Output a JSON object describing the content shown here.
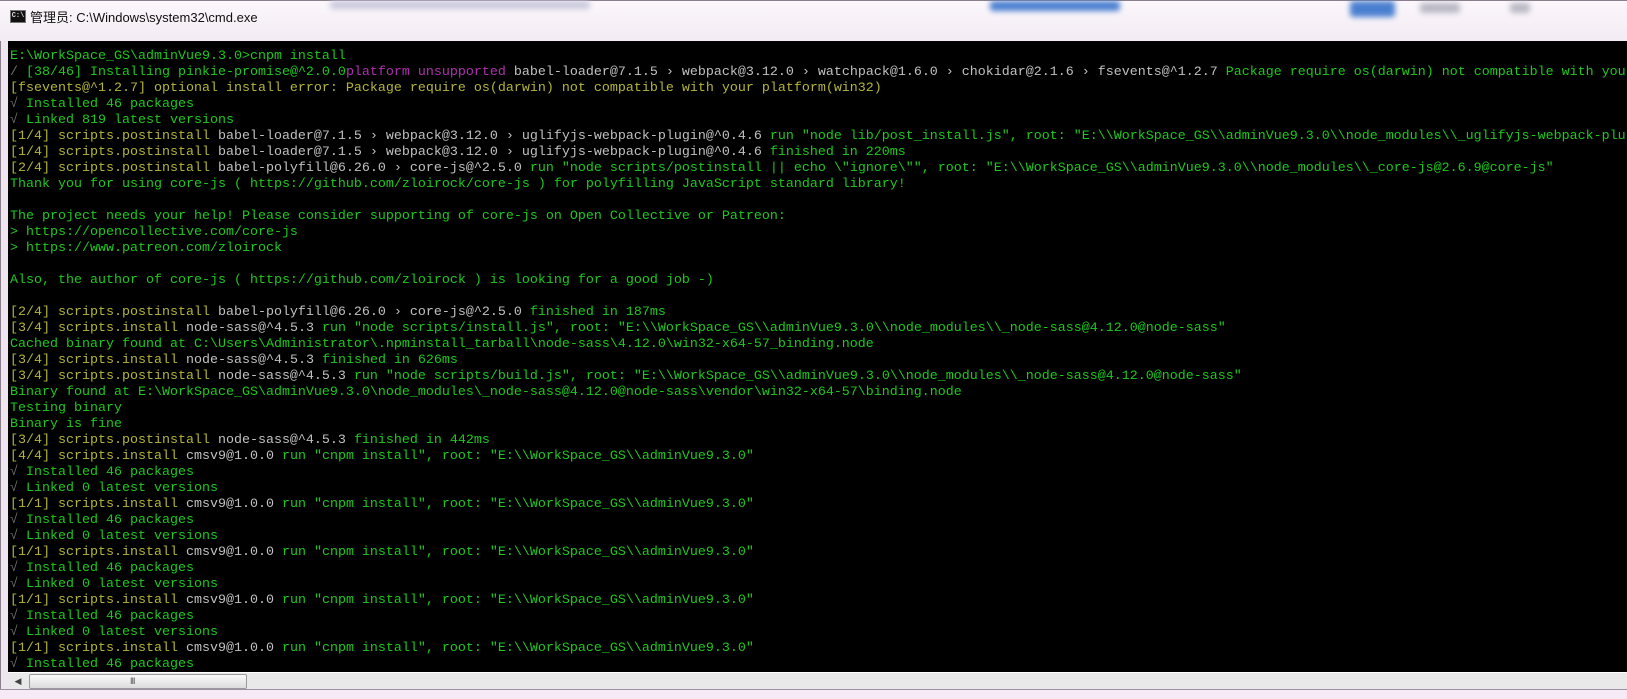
{
  "window": {
    "title": "管理员: C:\\Windows\\system32\\cmd.exe",
    "icon": "cmd-icon",
    "icon_text": "C:\\"
  },
  "colors": {
    "c": "#c0c0c0",
    "g": "#1ec81e",
    "y": "#b4b43a",
    "m": "#b030b0",
    "k": "#707070",
    "background": "#000000"
  },
  "terminal": {
    "lines": [
      [
        [
          "g",
          "E:\\WorkSpace_GS\\adminVue9.3.0>cnpm install"
        ]
      ],
      [
        [
          "k",
          "/ "
        ],
        [
          "g",
          "[38/46] Installing pinkie-promise@^2.0.0"
        ],
        [
          "m",
          "platform unsupported "
        ],
        [
          "c",
          "babel-loader@7.1.5 › webpack@3.12.0 › watchpack@1.6.0 › chokidar@2.1.6 › fsevents@^1.2.7 "
        ],
        [
          "g",
          "Package require os(darwin) not compatible with your"
        ]
      ],
      [
        [
          "y",
          "[fsevents@^1.2.7] optional install error: Package require os(darwin) not compatible with your platform(win32)"
        ]
      ],
      [
        [
          "k",
          "√ "
        ],
        [
          "g",
          "Installed 46 packages"
        ]
      ],
      [
        [
          "k",
          "√ "
        ],
        [
          "g",
          "Linked 819 latest versions"
        ]
      ],
      [
        [
          "y",
          "[1/4] scripts.postinstall "
        ],
        [
          "c",
          "babel-loader@7.1.5 › webpack@3.12.0 › uglifyjs-webpack-plugin@^0.4.6 "
        ],
        [
          "g",
          "run \"node lib/post_install.js\", root: \"E:\\\\WorkSpace_GS\\\\adminVue9.3.0\\\\node_modules\\\\_uglifyjs-webpack-plu"
        ]
      ],
      [
        [
          "y",
          "[1/4] scripts.postinstall "
        ],
        [
          "c",
          "babel-loader@7.1.5 › webpack@3.12.0 › uglifyjs-webpack-plugin@^0.4.6 "
        ],
        [
          "g",
          "finished in 220ms"
        ]
      ],
      [
        [
          "y",
          "[2/4] scripts.postinstall "
        ],
        [
          "c",
          "babel-polyfill@6.26.0 › core-js@^2.5.0 "
        ],
        [
          "g",
          "run \"node scripts/postinstall || echo \\\"ignore\\\"\", root: \"E:\\\\WorkSpace_GS\\\\adminVue9.3.0\\\\node_modules\\\\_core-js@2.6.9@core-js\""
        ]
      ],
      [
        [
          "g",
          "Thank you for using core-js ( https://github.com/zloirock/core-js ) for polyfilling JavaScript standard library!"
        ]
      ],
      [],
      [
        [
          "g",
          "The project needs your help! Please consider supporting of core-js on Open Collective or Patreon:"
        ]
      ],
      [
        [
          "g",
          "> https://opencollective.com/core-js"
        ]
      ],
      [
        [
          "g",
          "> https://www.patreon.com/zloirock"
        ]
      ],
      [],
      [
        [
          "g",
          "Also, the author of core-js ( https://github.com/zloirock ) is looking for a good job -)"
        ]
      ],
      [],
      [
        [
          "y",
          "[2/4] scripts.postinstall "
        ],
        [
          "c",
          "babel-polyfill@6.26.0 › core-js@^2.5.0 "
        ],
        [
          "g",
          "finished in 187ms"
        ]
      ],
      [
        [
          "y",
          "[3/4] scripts.install "
        ],
        [
          "c",
          "node-sass@^4.5.3 "
        ],
        [
          "g",
          "run \"node scripts/install.js\", root: \"E:\\\\WorkSpace_GS\\\\adminVue9.3.0\\\\node_modules\\\\_node-sass@4.12.0@node-sass\""
        ]
      ],
      [
        [
          "g",
          "Cached binary found at C:\\Users\\Administrator\\.npminstall_tarball\\node-sass\\4.12.0\\win32-x64-57_binding.node"
        ]
      ],
      [
        [
          "y",
          "[3/4] scripts.install "
        ],
        [
          "c",
          "node-sass@^4.5.3 "
        ],
        [
          "g",
          "finished in 626ms"
        ]
      ],
      [
        [
          "y",
          "[3/4] scripts.postinstall "
        ],
        [
          "c",
          "node-sass@^4.5.3 "
        ],
        [
          "g",
          "run \"node scripts/build.js\", root: \"E:\\\\WorkSpace_GS\\\\adminVue9.3.0\\\\node_modules\\\\_node-sass@4.12.0@node-sass\""
        ]
      ],
      [
        [
          "g",
          "Binary found at E:\\WorkSpace_GS\\adminVue9.3.0\\node_modules\\_node-sass@4.12.0@node-sass\\vendor\\win32-x64-57\\binding.node"
        ]
      ],
      [
        [
          "g",
          "Testing binary"
        ]
      ],
      [
        [
          "g",
          "Binary is fine"
        ]
      ],
      [
        [
          "y",
          "[3/4] scripts.postinstall "
        ],
        [
          "c",
          "node-sass@^4.5.3 "
        ],
        [
          "g",
          "finished in 442ms"
        ]
      ],
      [
        [
          "y",
          "[4/4] scripts.install "
        ],
        [
          "c",
          "cmsv9@1.0.0 "
        ],
        [
          "g",
          "run \"cnpm install\", root: \"E:\\\\WorkSpace_GS\\\\adminVue9.3.0\""
        ]
      ],
      [
        [
          "k",
          "√ "
        ],
        [
          "g",
          "Installed 46 packages"
        ]
      ],
      [
        [
          "k",
          "√ "
        ],
        [
          "g",
          "Linked 0 latest versions"
        ]
      ],
      [
        [
          "y",
          "[1/1] scripts.install "
        ],
        [
          "c",
          "cmsv9@1.0.0 "
        ],
        [
          "g",
          "run \"cnpm install\", root: \"E:\\\\WorkSpace_GS\\\\adminVue9.3.0\""
        ]
      ],
      [
        [
          "k",
          "√ "
        ],
        [
          "g",
          "Installed 46 packages"
        ]
      ],
      [
        [
          "k",
          "√ "
        ],
        [
          "g",
          "Linked 0 latest versions"
        ]
      ],
      [
        [
          "y",
          "[1/1] scripts.install "
        ],
        [
          "c",
          "cmsv9@1.0.0 "
        ],
        [
          "g",
          "run \"cnpm install\", root: \"E:\\\\WorkSpace_GS\\\\adminVue9.3.0\""
        ]
      ],
      [
        [
          "k",
          "√ "
        ],
        [
          "g",
          "Installed 46 packages"
        ]
      ],
      [
        [
          "k",
          "√ "
        ],
        [
          "g",
          "Linked 0 latest versions"
        ]
      ],
      [
        [
          "y",
          "[1/1] scripts.install "
        ],
        [
          "c",
          "cmsv9@1.0.0 "
        ],
        [
          "g",
          "run \"cnpm install\", root: \"E:\\\\WorkSpace_GS\\\\adminVue9.3.0\""
        ]
      ],
      [
        [
          "k",
          "√ "
        ],
        [
          "g",
          "Installed 46 packages"
        ]
      ],
      [
        [
          "k",
          "√ "
        ],
        [
          "g",
          "Linked 0 latest versions"
        ]
      ],
      [
        [
          "y",
          "[1/1] scripts.install "
        ],
        [
          "c",
          "cmsv9@1.0.0 "
        ],
        [
          "g",
          "run \"cnpm install\", root: \"E:\\\\WorkSpace_GS\\\\adminVue9.3.0\""
        ]
      ],
      [
        [
          "k",
          "√ "
        ],
        [
          "g",
          "Installed 46 packages"
        ]
      ]
    ]
  },
  "scrollbar": {
    "left_arrow": "◀",
    "grip": "III"
  }
}
